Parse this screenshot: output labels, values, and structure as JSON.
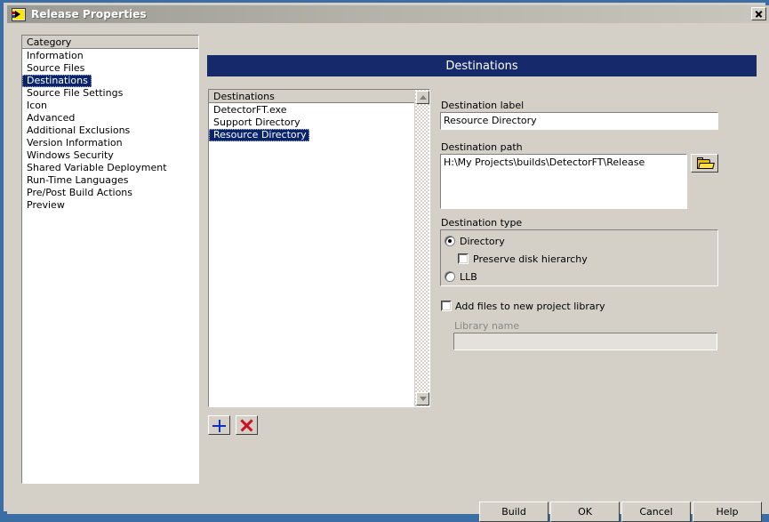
{
  "window": {
    "title": "Release Properties",
    "icon": "labview-vi-icon",
    "close_label": "Close"
  },
  "category_panel": {
    "header": "Category",
    "items": [
      {
        "label": "Information",
        "selected": false
      },
      {
        "label": "Source Files",
        "selected": false
      },
      {
        "label": "Destinations",
        "selected": true
      },
      {
        "label": "Source File Settings",
        "selected": false
      },
      {
        "label": "Icon",
        "selected": false
      },
      {
        "label": "Advanced",
        "selected": false
      },
      {
        "label": "Additional Exclusions",
        "selected": false
      },
      {
        "label": "Version Information",
        "selected": false
      },
      {
        "label": "Windows Security",
        "selected": false
      },
      {
        "label": "Shared Variable Deployment",
        "selected": false
      },
      {
        "label": "Run-Time Languages",
        "selected": false
      },
      {
        "label": "Pre/Post Build Actions",
        "selected": false
      },
      {
        "label": "Preview",
        "selected": false
      }
    ]
  },
  "banner": {
    "title": "Destinations"
  },
  "destinations_list": {
    "header": "Destinations",
    "items": [
      {
        "label": "DetectorFT.exe",
        "selected": false
      },
      {
        "label": "Support Directory",
        "selected": false
      },
      {
        "label": "Resource Directory",
        "selected": true
      }
    ]
  },
  "list_toolbar": {
    "add_label": "+",
    "delete_label": "X"
  },
  "form": {
    "destination_label": {
      "label": "Destination label",
      "value": "Resource Directory"
    },
    "destination_path": {
      "label": "Destination path",
      "value": "H:\\My Projects\\builds\\DetectorFT\\Release",
      "browse_icon": "folder-open-icon"
    },
    "destination_type": {
      "label": "Destination type",
      "options": [
        {
          "label": "Directory",
          "selected": true
        },
        {
          "label": "LLB",
          "selected": false
        }
      ],
      "preserve_disk_hierarchy": {
        "label": "Preserve disk hierarchy",
        "checked": false
      }
    },
    "add_files_to_library": {
      "label": "Add files to new project library",
      "checked": false
    },
    "library_name": {
      "label": "Library name",
      "value": "",
      "disabled": true
    }
  },
  "buttons": {
    "build": "Build",
    "ok": "OK",
    "cancel": "Cancel",
    "help": "Help"
  },
  "colors": {
    "window_frame": "#3a6ea5",
    "dialog_face": "#d4d0c8",
    "banner_bg": "#15296b",
    "selection_bg": "#0a246a",
    "accent_add": "#1030c0",
    "accent_delete": "#cc1122",
    "folder_icon": "#f0c000"
  }
}
